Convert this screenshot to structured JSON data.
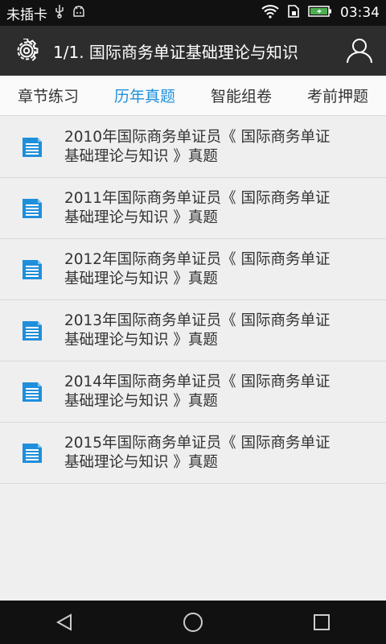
{
  "status_bar": {
    "carrier": "未插卡",
    "time": "03:34",
    "icons": [
      "usb-icon",
      "android-debug-icon",
      "wifi-icon",
      "sim-icon",
      "battery-charging-icon"
    ]
  },
  "app_bar": {
    "title": "1/1. 国际商务单证基础理论与知识",
    "left_icon": "gear-icon",
    "right_icon": "user-icon"
  },
  "tabs": [
    {
      "label": "章节练习",
      "active": false
    },
    {
      "label": "历年真题",
      "active": true
    },
    {
      "label": "智能组卷",
      "active": false
    },
    {
      "label": "考前押题",
      "active": false
    }
  ],
  "list": [
    {
      "line1": "2010年国际商务单证员《 国际商务单证",
      "line2": "基础理论与知识 》真题"
    },
    {
      "line1": "2011年国际商务单证员《 国际商务单证",
      "line2": "基础理论与知识 》真题"
    },
    {
      "line1": "2012年国际商务单证员《 国际商务单证",
      "line2": "基础理论与知识 》真题"
    },
    {
      "line1": "2013年国际商务单证员《 国际商务单证",
      "line2": "基础理论与知识 》真题"
    },
    {
      "line1": "2014年国际商务单证员《 国际商务单证",
      "line2": "基础理论与知识 》真题"
    },
    {
      "line1": "2015年国际商务单证员《 国际商务单证",
      "line2": "基础理论与知识 》真题"
    }
  ],
  "colors": {
    "accent": "#1f8fdb",
    "app_bar": "#2d2d2d",
    "status_bar": "#111111",
    "list_bg": "#efefef"
  }
}
